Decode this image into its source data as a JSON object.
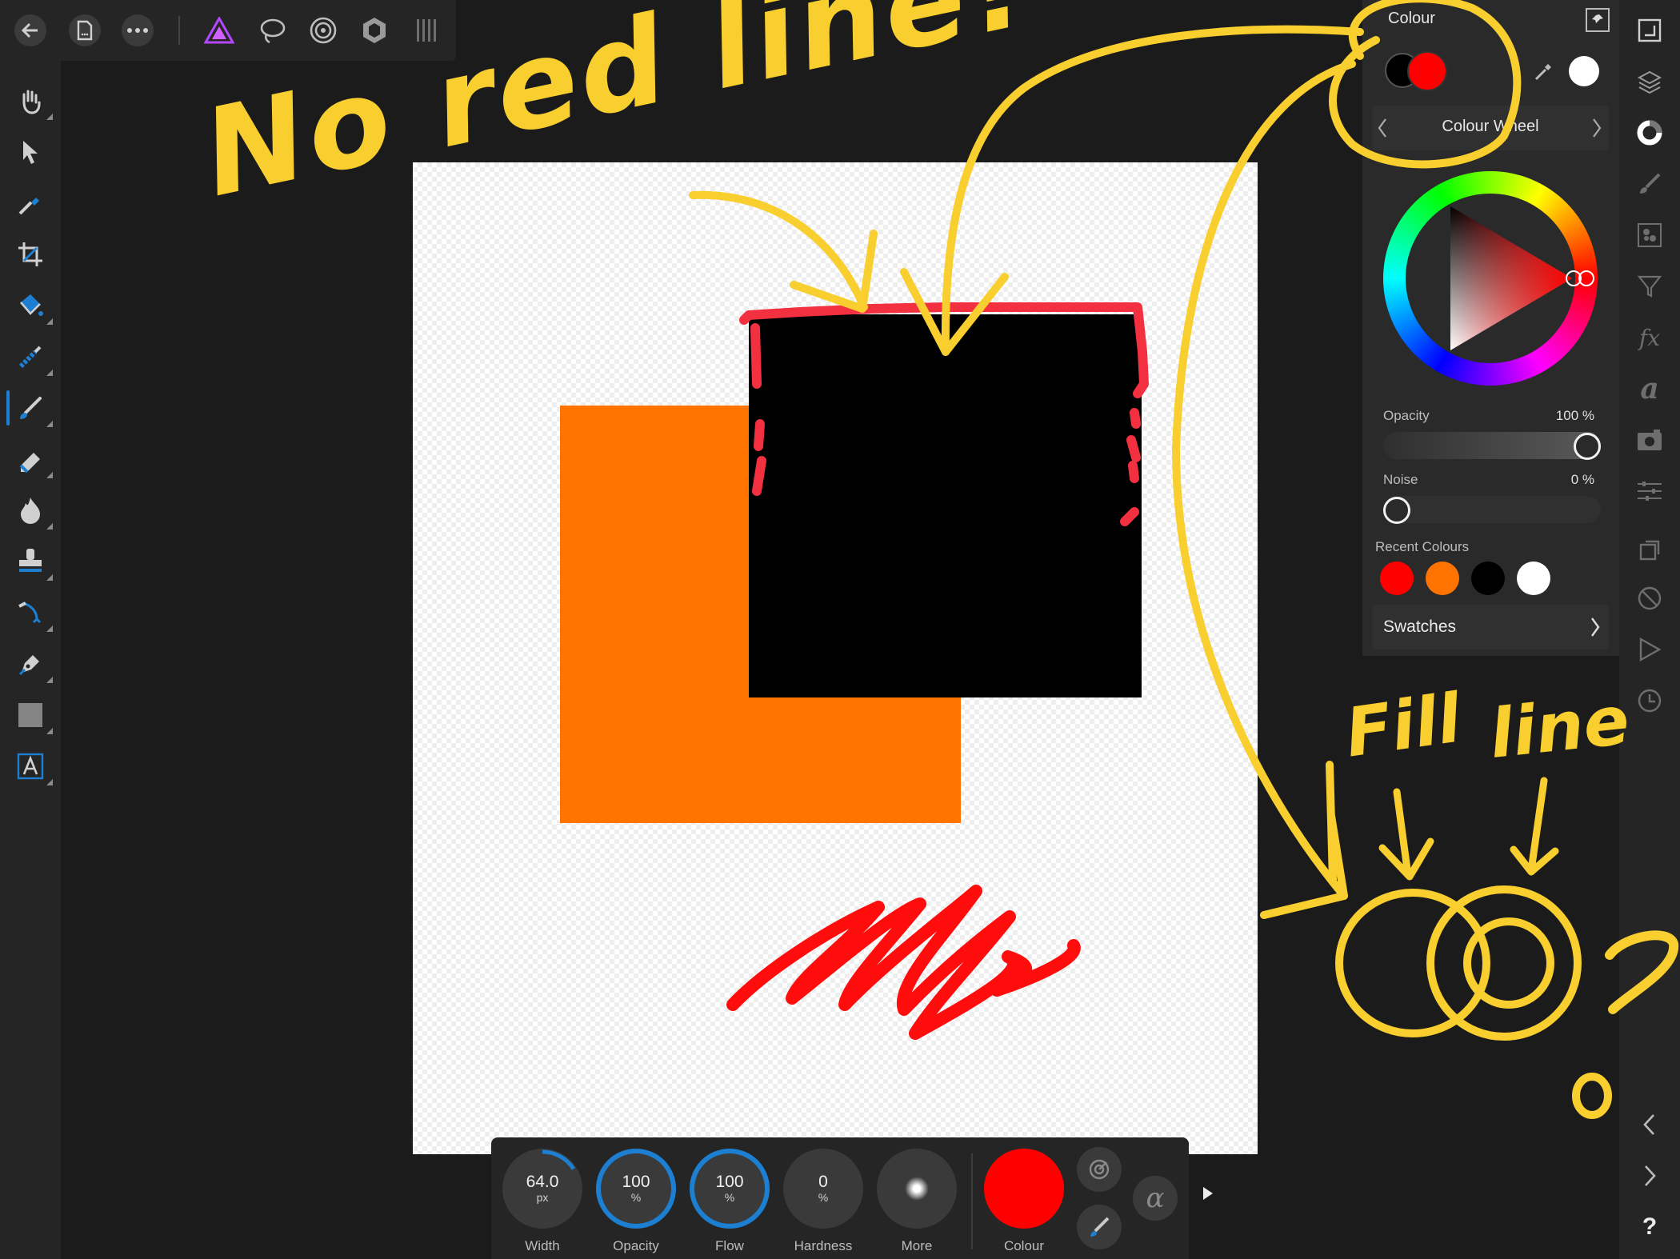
{
  "colours": {
    "accent_blue": "#1d7fd1",
    "annotation_yellow": "#f8cf2e",
    "red": "#ff0000",
    "orange": "#ff7300",
    "black": "#000000",
    "white": "#ffffff"
  },
  "topbar": {
    "icons": [
      "back-arrow-icon",
      "document-icon",
      "more-dots-icon",
      "affinity-persona-icon",
      "lasso-icon",
      "liquify-icon",
      "develop-icon",
      "export-icon"
    ]
  },
  "left_tools": [
    "view-hand-icon",
    "move-arrow-icon",
    "colour-picker-icon",
    "crop-icon",
    "flood-fill-icon",
    "selection-brush-icon",
    "paint-brush-icon",
    "erase-brush-icon",
    "dodge-burn-icon",
    "clone-stamp-icon",
    "healing-icon",
    "pen-icon",
    "rectangle-shape-icon",
    "text-tool-icon"
  ],
  "right_studio": [
    "navigator-icon",
    "layers-icon",
    "colour-studio-icon",
    "brushes-icon",
    "channels-icon",
    "adjustments-icon",
    "effects-fx-icon",
    "character-text-icon",
    "stock-camera-icon",
    "transform-sliders-icon",
    "snapshot-icon",
    "history-icon",
    "macro-play-icon",
    "clock-icon",
    "prev-chevron-icon",
    "next-chevron-icon",
    "help-icon"
  ],
  "colour_panel": {
    "title": "Colour",
    "mode_label": "Colour Wheel",
    "opacity_label": "Opacity",
    "opacity_value": "100 %",
    "opacity_level": 1.0,
    "noise_label": "Noise",
    "noise_value": "0 %",
    "noise_level": 0.0,
    "recent_label": "Recent Colours",
    "recent_colours": [
      "#ff0000",
      "#ff7300",
      "#000000",
      "#ffffff"
    ],
    "swatches_label": "Swatches",
    "fill_colour": "#000000",
    "line_colour": "#ff0000"
  },
  "context_bar": {
    "width_value": "64.0",
    "width_unit": "px",
    "width_label": "Width",
    "width_level": 0.16,
    "opacity_value": "100",
    "opacity_unit": "%",
    "opacity_label": "Opacity",
    "flow_value": "100",
    "flow_unit": "%",
    "flow_label": "Flow",
    "hardness_value": "0",
    "hardness_unit": "%",
    "hardness_label": "Hardness",
    "more_label": "More",
    "colour_label": "Colour",
    "alpha_symbol": "α"
  },
  "annotations": {
    "headline": "No red line?",
    "fill": "Fill",
    "line": "line"
  }
}
